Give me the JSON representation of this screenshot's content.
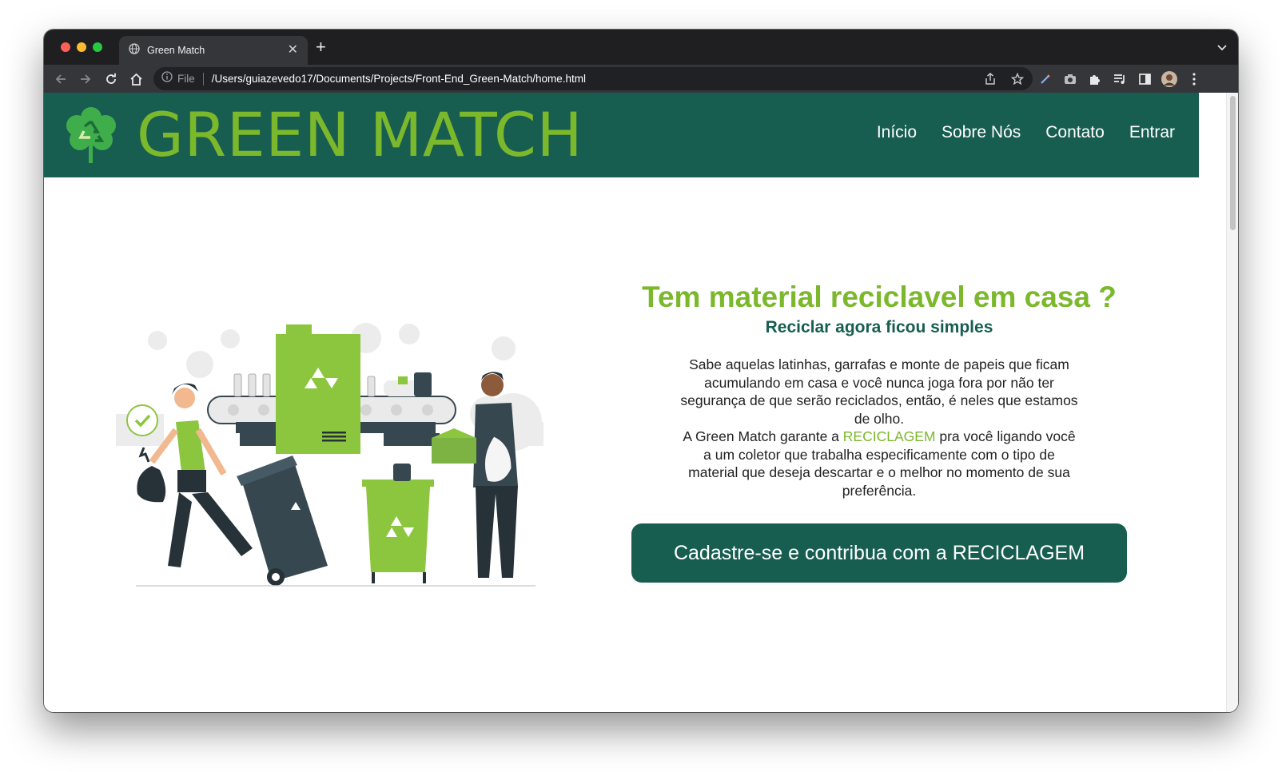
{
  "browser": {
    "tab_title": "Green Match",
    "file_label": "File",
    "url": "/Users/guiazevedo17/Documents/Projects/Front-End_Green-Match/home.html"
  },
  "site": {
    "brand": "GREEN MATCH",
    "nav": [
      "Início",
      "Sobre Nós",
      "Contato",
      "Entrar"
    ]
  },
  "hero": {
    "headline": "Tem material reciclavel em casa ?",
    "subheadline": "Reciclar agora ficou simples",
    "paragraph1": "Sabe aquelas latinhas, garrafas e monte de papeis que ficam acumulando em casa e você nunca joga fora por não ter segurança de que serão reciclados, então, é neles que estamos de olho.",
    "paragraph2_before": "A Green Match garante a ",
    "paragraph2_highlight": "RECICLAGEM",
    "paragraph2_after": " pra você ligando você a um coletor que trabalha especificamente com o tipo de material que deseja descartar e o melhor no momento de sua preferência.",
    "cta_label": "Cadastre-se e contribua com a RECICLAGEM"
  },
  "colors": {
    "brand_dark": "#175e51",
    "brand_green": "#7bb82b",
    "chrome_bg": "#35363a"
  }
}
